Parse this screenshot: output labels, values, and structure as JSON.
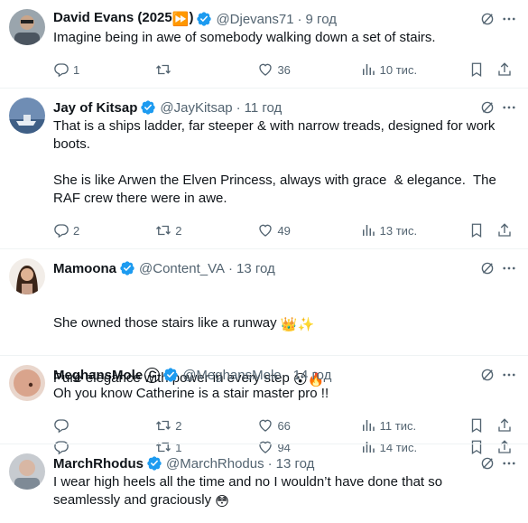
{
  "tweets": [
    {
      "name": "David Evans (2025",
      "name_suffix_emoji": "⏩",
      "name_close": ")",
      "handle": "@Djevans71",
      "dot": "·",
      "time": "9 год",
      "text": "Imagine being in awe of somebody walking down a set of stairs.",
      "replies": "1",
      "retweets": "",
      "likes": "36",
      "views": "10 тис."
    },
    {
      "name": "Jay of Kitsap",
      "handle": "@JayKitsap",
      "dot": "·",
      "time": "11 год",
      "text": "That is a ships ladder, far steeper & with narrow treads, designed for work boots.\n\nShe is like Arwen the Elven Princess, always with grace  & elegance.  The RAF crew there were in awe.",
      "replies": "2",
      "retweets": "2",
      "likes": "49",
      "views": "13 тис."
    },
    {
      "name": "Mamoona",
      "handle": "@Content_VA",
      "dot": "·",
      "time": "13 год",
      "text_line1": "She owned those stairs like a runway ",
      "text_line1_emoji": "👑✨",
      "text_line2": "Pure elegance with power in every step ",
      "text_line2_emoji": "😮🔥",
      "replies": "",
      "retweets": "1",
      "likes": "94",
      "views": "14 тис."
    },
    {
      "name": "MeghansMole",
      "name_badge": "C",
      "handle": "@MeghansMole",
      "dot": "·",
      "time": "14 год",
      "text": "Oh you know Catherine is a stair master pro !!",
      "replies": "",
      "retweets": "2",
      "likes": "66",
      "views": "11 тис."
    },
    {
      "name": "MarchRhodus",
      "handle": "@MarchRhodus",
      "dot": "·",
      "time": "13 год",
      "text": "I wear high heels all the time and no I wouldn’t have done that so seamlessly and graciously ",
      "text_emoji": "😳"
    }
  ],
  "icons": {
    "verified": "verified-badge-icon",
    "grok": "grok-icon",
    "more": "more-icon",
    "reply": "reply-icon",
    "retweet": "retweet-icon",
    "like": "heart-icon",
    "views": "views-icon",
    "bookmark": "bookmark-icon",
    "share": "share-icon"
  },
  "colors": {
    "text": "#0f1419",
    "secondary": "#536471",
    "verified": "#1d9bf0",
    "divider": "#eff3f4"
  }
}
